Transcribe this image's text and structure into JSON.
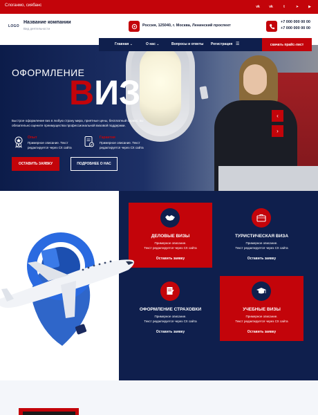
{
  "topbar": {
    "slogan": "Слоганмо, сиябанс",
    "social": [
      {
        "icon": "vk-icon",
        "glyph": "vk"
      },
      {
        "icon": "vk-alt-icon",
        "glyph": "vk"
      },
      {
        "icon": "twitter-icon",
        "glyph": "t"
      },
      {
        "icon": "telegram-icon",
        "glyph": "➤"
      },
      {
        "icon": "youtube-icon",
        "glyph": "▶"
      }
    ]
  },
  "header": {
    "logo": "LOGO",
    "company_name": "Название компании",
    "company_sub": "Вид деятельности",
    "address": "Россия, 125040, г. Москва, Ленинский проспект",
    "phone1": "+7 000 000 00 00",
    "phone2": "+7 000 000 00 00"
  },
  "nav": {
    "items": [
      {
        "label": "Главная",
        "dropdown": true
      },
      {
        "label": "О нас",
        "dropdown": true
      },
      {
        "label": "Вопросы и ответы",
        "dropdown": false
      },
      {
        "label": "Регистрация",
        "dropdown": false
      }
    ],
    "menu_icon": "menu-icon",
    "cta": "скачать прайс-лист"
  },
  "hero": {
    "subtitle": "ОФОРМЛЕНИЕ",
    "title_first": "В",
    "title_rest": "ИЗ",
    "description": "Быстрое оформление виз в любую страну мира, приятные цены, бесплатный сервис, вы обязательно оцените преимущества профессиональной визовой поддержки.",
    "features": [
      {
        "icon": "award-icon",
        "title": "Опыт",
        "text": "Примерное описание. Текст редактируется через СХ сайта"
      },
      {
        "icon": "document-icon",
        "title": "Гарантия",
        "text": "Примерное описание. Текст редактируется через СХ сайта"
      }
    ],
    "btn_primary": "ОСТАВИТЬ ЗАЯВКУ",
    "btn_secondary": "ПОДРОБНЕЕ О НАС",
    "arrow_prev": "‹",
    "arrow_next": "›"
  },
  "services": [
    {
      "variant": "red",
      "icon": "handshake-icon",
      "title": "ДЕЛОВЫЕ ВИЗЫ",
      "text1": "Примерное описание.",
      "text2": "Текст редактируется через СХ сайта",
      "link": "Оставить заявку"
    },
    {
      "variant": "dark",
      "icon": "suitcase-icon",
      "title": "ТУРИСТИЧЕСКАЯ ВИЗА",
      "text1": "Примерное описание.",
      "text2": "Текст редактируется через СХ сайта",
      "link": "Оставить заявку"
    },
    {
      "variant": "dark",
      "icon": "contract-icon",
      "title": "ОФОРМЛЕНИЕ СТРАХОВКИ",
      "text1": "Примерное описание.",
      "text2": "Текст редактируется через СХ сайта",
      "link": "Оставить заявку"
    },
    {
      "variant": "red",
      "icon": "graduation-cap-icon",
      "title": "УЧЕБНЫЕ ВИЗЫ",
      "text1": "Примерное описание.",
      "text2": "Текст редактируется через СХ сайта",
      "link": "Оставить заявку"
    }
  ],
  "colors": {
    "accent": "#c3040a",
    "navy": "#0f1f4d"
  }
}
